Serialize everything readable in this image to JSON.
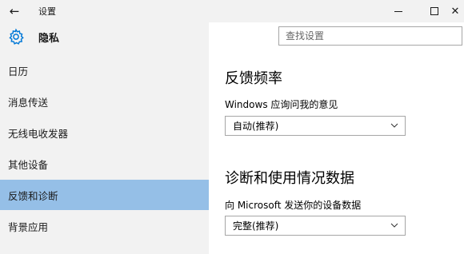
{
  "window": {
    "title": "设置",
    "back_icon": "back-arrow-icon",
    "min_icon": "minimize-icon",
    "max_icon": "maximize-icon",
    "close_icon": "close-icon",
    "close_glyph": "✕",
    "back_glyph": "←"
  },
  "header": {
    "icon": "gear-icon",
    "title": "隐私"
  },
  "search": {
    "placeholder": "查找设置"
  },
  "sidebar": {
    "items": [
      {
        "label": "日历",
        "selected": false
      },
      {
        "label": "消息传送",
        "selected": false
      },
      {
        "label": "无线电收发器",
        "selected": false
      },
      {
        "label": "其他设备",
        "selected": false
      },
      {
        "label": "反馈和诊断",
        "selected": true
      },
      {
        "label": "背景应用",
        "selected": false
      }
    ],
    "selected_color": "#95bfe7"
  },
  "main": {
    "feedback": {
      "heading": "反馈频率",
      "label": "Windows 应询问我的意见",
      "dropdown_value": "自动(推荐)"
    },
    "diagnostics": {
      "heading": "诊断和使用情况数据",
      "label": "向 Microsoft 发送你的设备数据",
      "dropdown_value": "完整(推荐)"
    }
  },
  "colors": {
    "pane_bg": "#f2f2f2",
    "accent": "#0078d7"
  }
}
